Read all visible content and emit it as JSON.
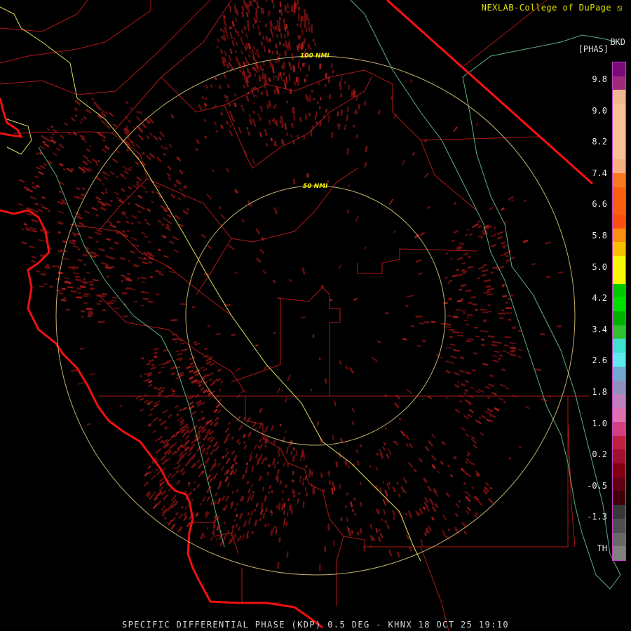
{
  "header": {
    "credit": "NEXLAB-College of DuPage",
    "site_code": "BKD",
    "product_code": "[PHAS]"
  },
  "footer": {
    "title": "SPECIFIC DIFFERENTIAL PHASE (KDP) 0.5 DEG - KHNX 18 OCT 25 19:10"
  },
  "rings": {
    "inner_label": "50 NMI",
    "outer_label": "100 NMI"
  },
  "legend": {
    "labels": [
      "9.8",
      "9.0",
      "8.2",
      "7.4",
      "6.6",
      "5.8",
      "5.0",
      "4.2",
      "3.4",
      "2.6",
      "1.8",
      "1.0",
      "0.2",
      "-0.5",
      "-1.3",
      "TH"
    ],
    "colors": [
      "#7a0a7a",
      "#a0287a",
      "#f0b890",
      "#f8c098",
      "#f8c098",
      "#f8c098",
      "#f8c098",
      "#f8b080",
      "#f87820",
      "#f86010",
      "#f86010",
      "#f85010",
      "#f89010",
      "#f8c000",
      "#f8f800",
      "#f8f800",
      "#00c800",
      "#00e000",
      "#00b000",
      "#30c030",
      "#40e0d0",
      "#60e8f0",
      "#70a8d0",
      "#9090c0",
      "#c080c0",
      "#e070b0",
      "#d04080",
      "#c02040",
      "#a01030",
      "#800010",
      "#600010",
      "#400008",
      "#383838",
      "#505050",
      "#686868",
      "#808080"
    ]
  }
}
